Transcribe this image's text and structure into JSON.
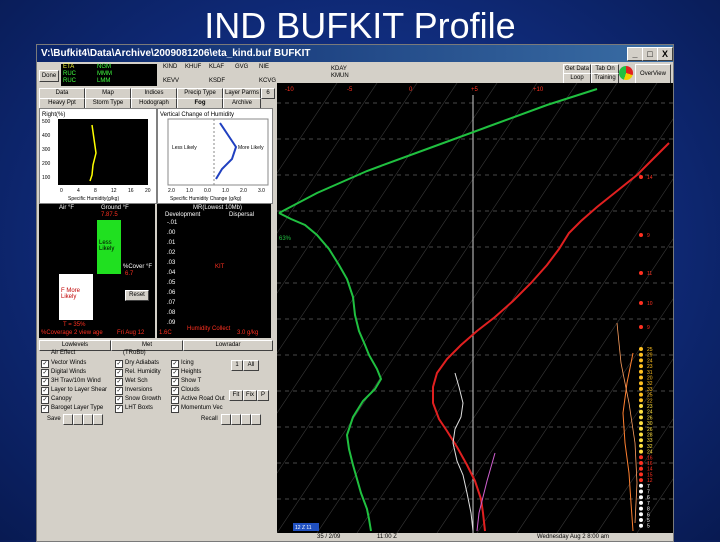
{
  "slide_title": "IND BUFKIT Profile",
  "window": {
    "title": "V:\\Bufkit4\\Data\\Archive\\2009081206\\eta_kind.buf BUFKIT",
    "controls": [
      "_",
      "□",
      "X"
    ]
  },
  "model_list": {
    "items": [
      "ETA",
      "RUC",
      "RUC"
    ],
    "sub": [
      "NGM",
      "MMM",
      "LMM"
    ]
  },
  "done_label": "Done",
  "stations": [
    {
      "id": "KIND",
      "alt": "KEVV"
    },
    {
      "id": "KHUF",
      "alt": ""
    },
    {
      "id": "KLAF",
      "alt": "KSDF"
    },
    {
      "id": "GVG",
      "alt": ""
    },
    {
      "id": "NIE",
      "alt": "KCVG"
    },
    {
      "id": "KDAY",
      "alt": ""
    },
    {
      "id": "KMUN",
      "alt": ""
    }
  ],
  "top_buttons": {
    "get_data": "Get Data",
    "tab_on": "Tab On",
    "loop": "Loop",
    "training": "Training",
    "overview": "OverView"
  },
  "menu_tabs": [
    "Data",
    "Map",
    "Indices",
    "Precip Type",
    "Layer Parms",
    "6"
  ],
  "menu_tabs2": [
    "Heavy Ppt",
    "Storm Type",
    "Hodograph",
    "Fog",
    "Archive"
  ],
  "rh_panel": {
    "title": "Right(%)",
    "ylabels": [
      "500",
      "400",
      "300",
      "200",
      "100"
    ],
    "xlabel": "Specific Humidity(g/kg)",
    "xticks": [
      "0",
      "4",
      "8",
      "12",
      "16",
      "20"
    ]
  },
  "hum_panel": {
    "title": "Vertical Change of Humidity",
    "less": "Less Likely",
    "more": "More Likely",
    "xlabel": "Specific Humidity Change (g/kg)",
    "xticks": [
      "2.0",
      "1.0",
      "0.0",
      "1.0",
      "2.0",
      "3.0"
    ]
  },
  "air_panel": {
    "air": "Air °F",
    "ground": "Ground °F",
    "ground_val": "7.87.5",
    "less_likely": "Less Likely",
    "cover": "%Cover °F",
    "cover_val": "6.7",
    "reset": "Reset",
    "f_more": "F More Likely",
    "t_val": "T = 35%",
    "bottom": "%Coverage 2 view age",
    "date": "Fri Aug 12"
  },
  "mr_panel": {
    "title": "MR(Lowest 10Mb)",
    "development": "Development",
    "dispersal": "Dispersal",
    "yticks": [
      "-.01",
      ".00",
      ".01",
      ".02",
      ".03",
      ".04",
      ".05",
      ".06",
      ".07",
      ".08",
      ".09"
    ],
    "marker": "KIT",
    "bottom_left": "1.6C",
    "bottom_mid": "Humidity Collect",
    "bottom_right": "3.0 g/kg"
  },
  "left_tabs": [
    "Lowlevels",
    "Met",
    "Lowradar"
  ],
  "left_tabs_sub": [
    "Air Effect",
    "(TRoBb)"
  ],
  "checkboxes": {
    "col1": [
      "Vector Winds",
      "Digital Winds",
      "3H Trav/10m Wind",
      "Layer to Layer Shear",
      "Canopy",
      "Baroget Layer Type"
    ],
    "col2": [
      "Dry Adiabats",
      "Rel. Humidity",
      "Wet Sch",
      "Inversions",
      "Snow Growth",
      "LHT Boxts"
    ],
    "col3": [
      "Icing",
      "Heights",
      "Show T",
      "Clouds",
      "Active Road Out",
      "Momentum Vec"
    ]
  },
  "num_buttons": [
    "1",
    "All",
    "Fit",
    "Fix",
    "P"
  ],
  "save_label": "Save",
  "recall_label": "Recall",
  "skewt": {
    "x_top": [
      "-10",
      "-5",
      "0",
      "+5",
      "+10"
    ],
    "right_labels": [
      "14",
      "9",
      "11",
      "10",
      "9",
      "25",
      "29",
      "24",
      "23",
      "31",
      "20",
      "32",
      "33",
      "25",
      "22",
      "23",
      "24",
      "26",
      "30",
      "26",
      "28",
      "33",
      "32",
      "24",
      "16",
      "16",
      "14",
      "15",
      "12",
      "7",
      "7",
      "6",
      "7",
      "8",
      "6",
      "5",
      "5"
    ],
    "x_bottom": [
      "-30",
      "-20",
      "-10",
      "0",
      "10",
      "20",
      "30"
    ],
    "bottom_tag": "12 Z 11",
    "date_text": "Wednesday  Aug  2  8:00 am",
    "status_left": "35 / 2/09",
    "status_mid": "11:00 Z",
    "label_65": "63%"
  },
  "colors": {
    "temperature": "#e02020",
    "dewpoint": "#20c040",
    "accent": "#ff3020"
  }
}
